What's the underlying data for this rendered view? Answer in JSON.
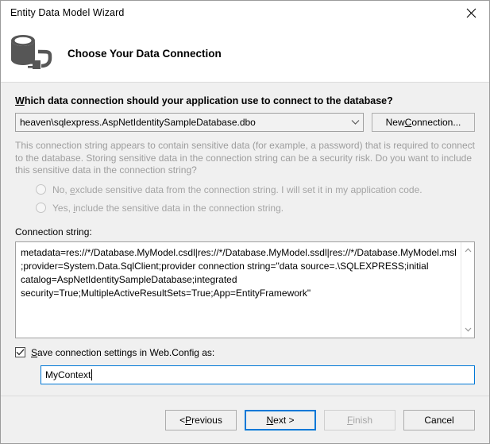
{
  "window": {
    "title": "Entity Data Model Wizard",
    "close_icon": "close-icon"
  },
  "header": {
    "title": "Choose Your Data Connection",
    "icon": "database-connection-icon"
  },
  "main": {
    "question": "Which data connection should your application use to connect to the database?",
    "question_accel": "W",
    "question_rest": "hich data connection should your application use to connect to the database?",
    "connection_combo": {
      "value": "heaven\\sqlexpress.AspNetIdentitySampleDatabase.dbo",
      "arrow_icon": "chevron-down-icon"
    },
    "new_connection_button": {
      "label_pre": "New ",
      "label_accel": "C",
      "label_post": "onnection..."
    },
    "sensitive_note": "This connection string appears to contain sensitive data (for example, a password) that is required to connect to the database. Storing sensitive data in the connection string can be a security risk. Do you want to include this sensitive data in the connection string?",
    "radios": [
      {
        "label_pre": "No, ",
        "label_accel": "e",
        "label_post": "xclude sensitive data from the connection string. I will set it in my application code.",
        "selected": false,
        "disabled": true
      },
      {
        "label_pre": "Yes, ",
        "label_accel": "i",
        "label_post": "nclude the sensitive data in the connection string.",
        "selected": false,
        "disabled": true
      }
    ],
    "connection_string_label": "Connection string:",
    "connection_string_value": "metadata=res://*/Database.MyModel.csdl|res://*/Database.MyModel.ssdl|res://*/Database.MyModel.msl;provider=System.Data.SqlClient;provider connection string=\"data source=.\\SQLEXPRESS;initial catalog=AspNetIdentitySampleDatabase;integrated security=True;MultipleActiveResultSets=True;App=EntityFramework\"",
    "scrollbar": {
      "up_icon": "chevron-up-icon",
      "down_icon": "chevron-down-icon"
    },
    "save_checkbox": {
      "checked": true,
      "label_pre": "",
      "label_accel": "S",
      "label_post": "ave connection settings in Web.Config as:"
    },
    "context_name_input": {
      "value": "MyContext",
      "focused": true
    }
  },
  "footer": {
    "buttons": [
      {
        "label_pre": "< ",
        "label_accel": "P",
        "label_post": "revious",
        "disabled": false,
        "default": false
      },
      {
        "label_pre": "",
        "label_accel": "N",
        "label_post": "ext >",
        "disabled": false,
        "default": true
      },
      {
        "label_pre": "",
        "label_accel": "F",
        "label_post": "inish",
        "disabled": true,
        "default": false
      },
      {
        "label_pre": "",
        "label_accel": "",
        "label_post": "Cancel",
        "disabled": false,
        "default": false
      }
    ]
  },
  "colors": {
    "accent": "#0078d7",
    "dialog_bg": "#f0f0f0",
    "header_bg": "#ffffff",
    "disabled_text": "#a6a6a6",
    "icon_grey": "#565656"
  }
}
